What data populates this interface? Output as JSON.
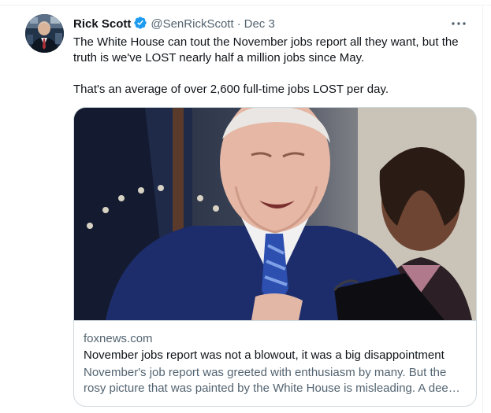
{
  "tweet": {
    "author_name": "Rick Scott",
    "handle": "@SenRickScott",
    "separator": "·",
    "date": "Dec 3",
    "paragraph_1": "The White House can tout the November jobs report all they want, but the truth is we've LOST nearly half a million jobs since May.",
    "paragraph_2": "That's an average of over 2,600 full-time jobs LOST per day."
  },
  "card": {
    "domain": "foxnews.com",
    "title": "November jobs report was not a blowout, it was a big disappointment",
    "description": "November's job report was greeted with enthusiasm by many. But the rosy picture that was painted by the White House is misleading. A deeper look at the data shows the November report was a disappointment."
  },
  "icons": {
    "verified": "verified-badge-icon",
    "more": "more-options-icon"
  },
  "colors": {
    "verified": "#1d9bf0",
    "secondary_text": "#536471",
    "border": "#cfd9de"
  }
}
